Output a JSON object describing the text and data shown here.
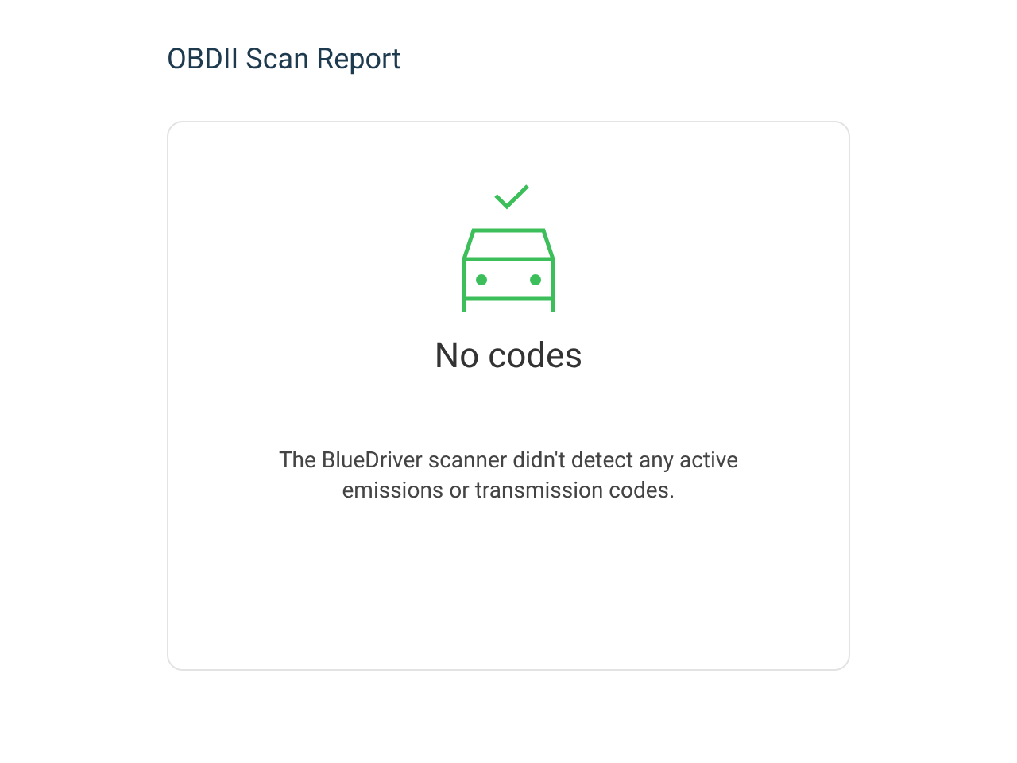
{
  "title": "OBDII Scan Report",
  "result": {
    "heading": "No codes",
    "message": "The BlueDriver scanner didn't detect any active emissions or transmission codes."
  }
}
